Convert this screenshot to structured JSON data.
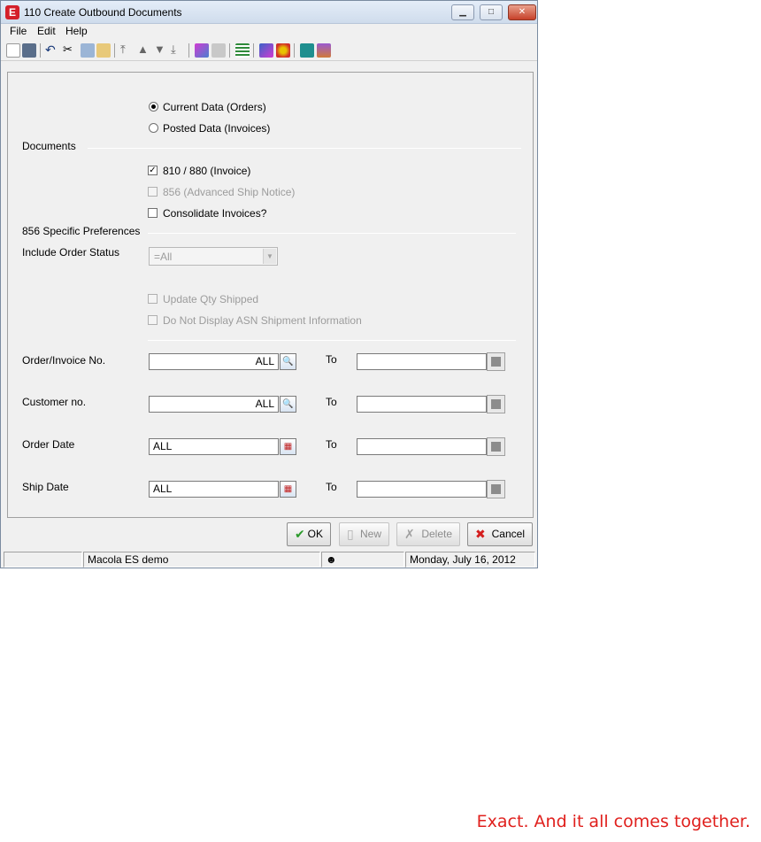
{
  "window": {
    "title": "110 Create Outbound Documents",
    "app_icon_letter": "E"
  },
  "menu": {
    "file": "File",
    "edit": "Edit",
    "help": "Help"
  },
  "options": {
    "current_data": "Current Data (Orders)",
    "posted_data": "Posted Data (Invoices)",
    "selected": "current_data"
  },
  "documents": {
    "heading": "Documents",
    "doc810": "810 / 880 (Invoice)",
    "doc856": "856 (Advanced Ship Notice)",
    "consolidate": "Consolidate Invoices?"
  },
  "prefs856": {
    "heading": "856 Specific Preferences",
    "include_status_label": "Include Order Status",
    "include_status_value": "=All",
    "update_qty": "Update Qty Shipped",
    "no_asn": "Do Not Display ASN Shipment Information"
  },
  "ranges": {
    "to_label": "To",
    "order_invoice": {
      "label": "Order/Invoice No.",
      "from": "ALL",
      "to": ""
    },
    "customer": {
      "label": "Customer no.",
      "from": "ALL",
      "to": ""
    },
    "order_date": {
      "label": "Order Date",
      "from": "ALL",
      "to": ""
    },
    "ship_date": {
      "label": "Ship Date",
      "from": "ALL",
      "to": ""
    }
  },
  "buttons": {
    "ok": "OK",
    "new": "New",
    "delete": "Delete",
    "cancel": "Cancel"
  },
  "status": {
    "company": "Macola ES demo",
    "date": "Monday, July 16, 2012"
  },
  "tagline": "Exact. And it all comes together.",
  "colors": {
    "accent_red": "#e0201d",
    "title_bg": "#dbe6f4"
  }
}
